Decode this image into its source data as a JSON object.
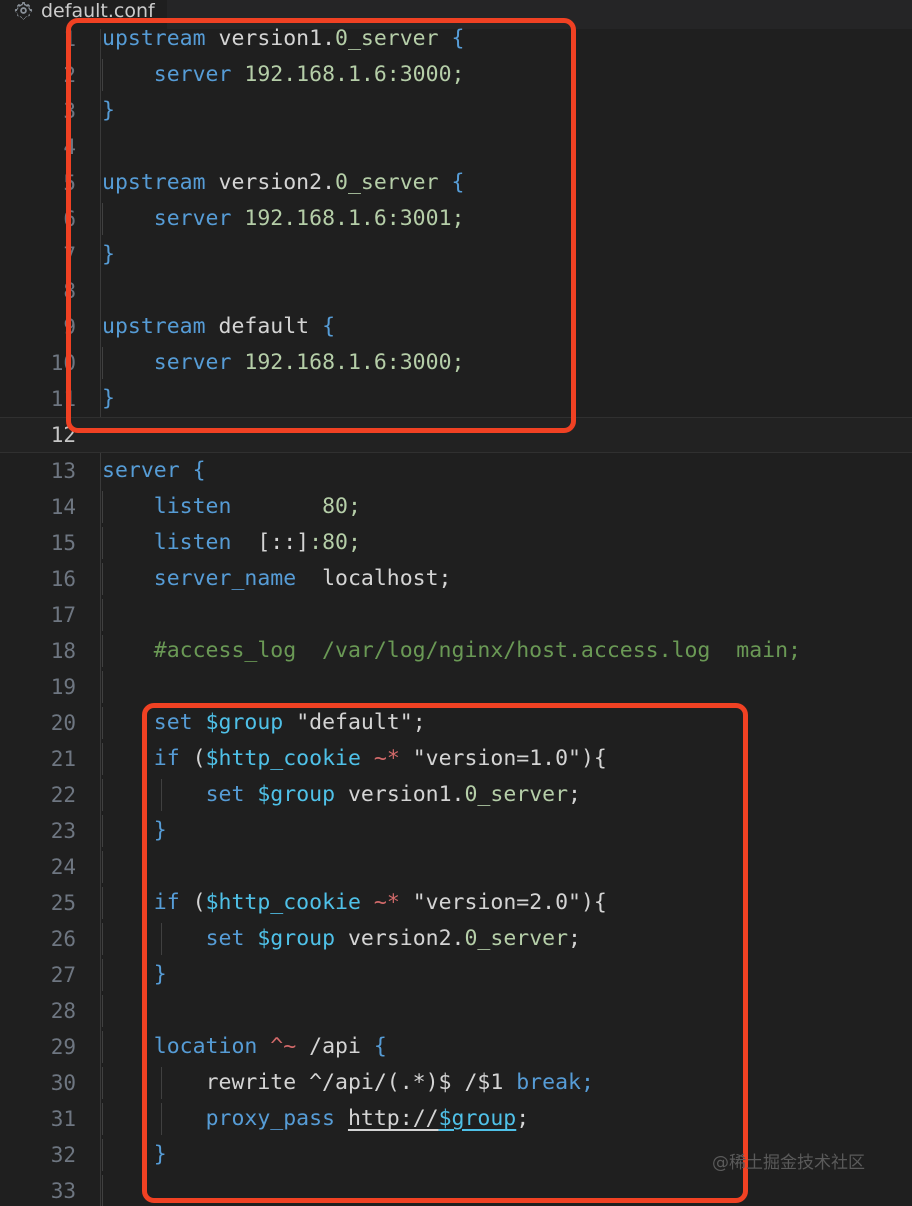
{
  "window": {
    "title": "default.conf",
    "background": "#1f1f1f",
    "tab_background": "#252526"
  },
  "tab": {
    "icon": "gear-icon",
    "label": "default.conf",
    "icon_color": "#8a9199"
  },
  "annotations": {
    "accent_color": "#f04123",
    "boxes": [
      {
        "name": "upstream-block-highlight",
        "lines": "1-11"
      },
      {
        "name": "routing-block-highlight",
        "lines": "20-32"
      }
    ]
  },
  "watermark": {
    "text": "@稀土掘金技术社区",
    "color": "#5a5a5a"
  },
  "editor": {
    "language": "nginx",
    "active_line": 12,
    "first_line": 1,
    "last_line": 33,
    "colors": {
      "keyword": "#569cd6",
      "variable": "#4fc1e8",
      "number": "#b5cea8",
      "text": "#d4d4d4",
      "comment": "#6a9955",
      "regex_operator": "#d16969",
      "line_number": "#6e7681"
    },
    "lines": [
      {
        "n": 1,
        "indent": 0,
        "html": "<span class=\"k\">upstream</span> <span class=\"s\">version1.</span><span class=\"n\">0_server</span> <span class=\"br\">{</span>"
      },
      {
        "n": 2,
        "indent": 1,
        "html": "    <span class=\"k\">server</span> <span class=\"n\">192.168.1.6:3000;</span>"
      },
      {
        "n": 3,
        "indent": 0,
        "html": "<span class=\"br\">}</span>"
      },
      {
        "n": 4,
        "indent": 0,
        "html": ""
      },
      {
        "n": 5,
        "indent": 0,
        "html": "<span class=\"k\">upstream</span> <span class=\"s\">version2.</span><span class=\"n\">0_server</span> <span class=\"br\">{</span>"
      },
      {
        "n": 6,
        "indent": 1,
        "html": "    <span class=\"k\">server</span> <span class=\"n\">192.168.1.6:3001;</span>"
      },
      {
        "n": 7,
        "indent": 0,
        "html": "<span class=\"br\">}</span>"
      },
      {
        "n": 8,
        "indent": 0,
        "html": ""
      },
      {
        "n": 9,
        "indent": 0,
        "html": "<span class=\"k\">upstream</span> <span class=\"s\">default</span> <span class=\"br\">{</span>"
      },
      {
        "n": 10,
        "indent": 1,
        "html": "    <span class=\"k\">server</span> <span class=\"n\">192.168.1.6:3000;</span>"
      },
      {
        "n": 11,
        "indent": 0,
        "html": "<span class=\"br\">}</span>"
      },
      {
        "n": 12,
        "indent": 0,
        "html": ""
      },
      {
        "n": 13,
        "indent": 0,
        "html": "<span class=\"k\">server</span> <span class=\"br\">{</span>"
      },
      {
        "n": 14,
        "indent": 1,
        "html": "    <span class=\"k\">listen</span>       <span class=\"n\">80;</span>"
      },
      {
        "n": 15,
        "indent": 1,
        "html": "    <span class=\"k\">listen</span>  <span class=\"s\">[::]</span><span class=\"n\">:80;</span>"
      },
      {
        "n": 16,
        "indent": 1,
        "html": "    <span class=\"k\">server_name</span>  <span class=\"s\">localhost;</span>"
      },
      {
        "n": 17,
        "indent": 1,
        "html": ""
      },
      {
        "n": 18,
        "indent": 1,
        "html": "    <span class=\"c\">#access_log  /var/log/nginx/host.access.log  main;</span>"
      },
      {
        "n": 19,
        "indent": 1,
        "html": ""
      },
      {
        "n": 20,
        "indent": 1,
        "html": "    <span class=\"k\">set</span> <span class=\"v\">$group</span> <span class=\"s\">\"default\";</span>"
      },
      {
        "n": 21,
        "indent": 1,
        "html": "    <span class=\"k\">if</span> <span class=\"s\">(</span><span class=\"v\">$http_cookie</span> <span class=\"op\">~*</span> <span class=\"s\">\"version=1.0\"){</span>"
      },
      {
        "n": 22,
        "indent": 2,
        "html": "        <span class=\"k\">set</span> <span class=\"v\">$group</span> <span class=\"s\">version1.</span><span class=\"n\">0_server</span><span class=\"s\">;</span>"
      },
      {
        "n": 23,
        "indent": 1,
        "html": "    <span class=\"br\">}</span>"
      },
      {
        "n": 24,
        "indent": 1,
        "html": ""
      },
      {
        "n": 25,
        "indent": 1,
        "html": "    <span class=\"k\">if</span> <span class=\"s\">(</span><span class=\"v\">$http_cookie</span> <span class=\"op\">~*</span> <span class=\"s\">\"version=2.0\"){</span>"
      },
      {
        "n": 26,
        "indent": 2,
        "html": "        <span class=\"k\">set</span> <span class=\"v\">$group</span> <span class=\"s\">version2.</span><span class=\"n\">0_server</span><span class=\"s\">;</span>"
      },
      {
        "n": 27,
        "indent": 1,
        "html": "    <span class=\"br\">}</span>"
      },
      {
        "n": 28,
        "indent": 1,
        "html": ""
      },
      {
        "n": 29,
        "indent": 1,
        "html": "    <span class=\"k\">location</span> <span class=\"op\">^~</span> <span class=\"s\">/api</span> <span class=\"br\">{</span>"
      },
      {
        "n": 30,
        "indent": 2,
        "html": "        <span class=\"s\">rewrite ^/api/(.*)$ /$1</span> <span class=\"k\">break;</span>"
      },
      {
        "n": 31,
        "indent": 2,
        "html": "        <span class=\"k\">proxy_pass</span> <span class=\"link\">http://</span><span class=\"linkv\">$group</span><span class=\"s\">;</span>"
      },
      {
        "n": 32,
        "indent": 1,
        "html": "    <span class=\"br\">}</span>"
      },
      {
        "n": 33,
        "indent": 1,
        "html": ""
      }
    ],
    "plain_text": [
      "upstream version1.0_server {",
      "    server 192.168.1.6:3000;",
      "}",
      "",
      "upstream version2.0_server {",
      "    server 192.168.1.6:3001;",
      "}",
      "",
      "upstream default {",
      "    server 192.168.1.6:3000;",
      "}",
      "",
      "server {",
      "    listen       80;",
      "    listen  [::]:80;",
      "    server_name  localhost;",
      "",
      "    #access_log  /var/log/nginx/host.access.log  main;",
      "",
      "    set $group \"default\";",
      "    if ($http_cookie ~* \"version=1.0\"){",
      "        set $group version1.0_server;",
      "    }",
      "",
      "    if ($http_cookie ~* \"version=2.0\"){",
      "        set $group version2.0_server;",
      "    }",
      "",
      "    location ^~ /api {",
      "        rewrite ^/api/(.*)$ /$1 break;",
      "        proxy_pass http://$group;",
      "    }",
      ""
    ]
  }
}
